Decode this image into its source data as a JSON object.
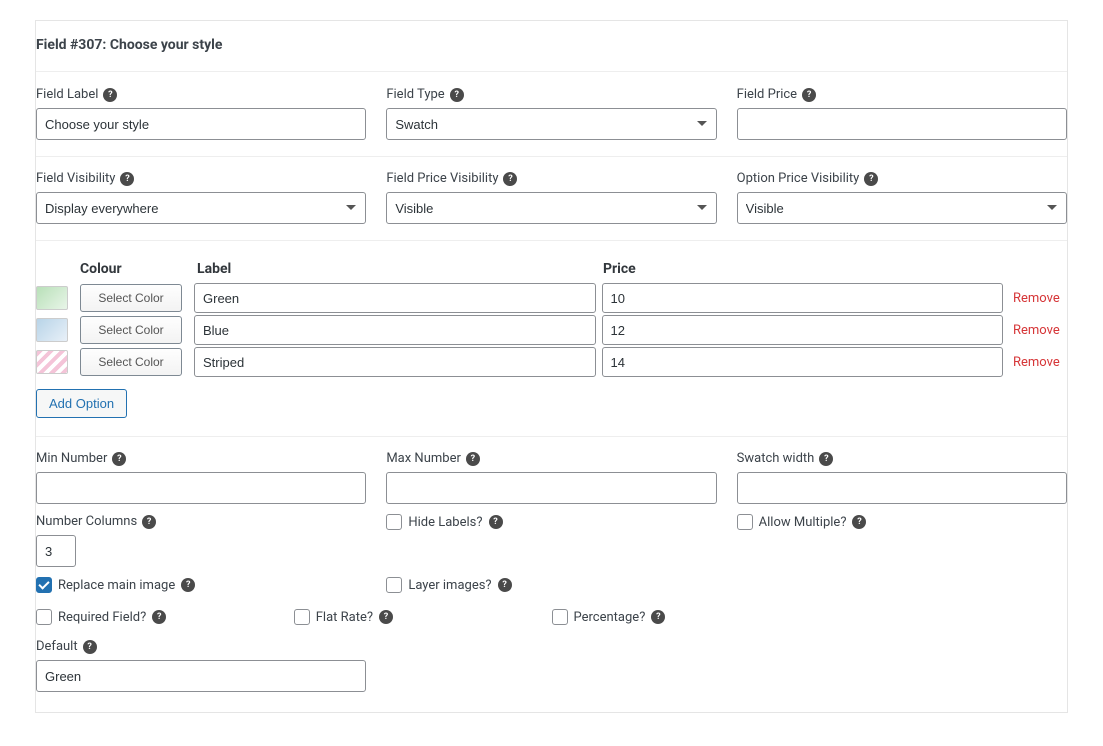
{
  "header": {
    "title": "Field #307: Choose your style"
  },
  "labels": {
    "field_label": "Field Label",
    "field_type": "Field Type",
    "field_price": "Field Price",
    "field_visibility": "Field Visibility",
    "field_price_visibility": "Field Price Visibility",
    "option_price_visibility": "Option Price Visibility",
    "min_number": "Min Number",
    "max_number": "Max Number",
    "swatch_width": "Swatch width",
    "number_columns": "Number Columns",
    "hide_labels": "Hide Labels?",
    "allow_multiple": "Allow Multiple?",
    "replace_main_image": "Replace main image",
    "layer_images": "Layer images?",
    "required_field": "Required Field?",
    "flat_rate": "Flat Rate?",
    "percentage": "Percentage?",
    "default": "Default",
    "add_option": "Add Option",
    "select_color": "Select Color",
    "remove": "Remove",
    "col_colour": "Colour",
    "col_label": "Label",
    "col_price": "Price"
  },
  "values": {
    "field_label": "Choose your style",
    "field_type": "Swatch",
    "field_price": "",
    "field_visibility": "Display everywhere",
    "field_price_visibility": "Visible",
    "option_price_visibility": "Visible",
    "min_number": "",
    "max_number": "",
    "swatch_width": "",
    "number_columns": "3",
    "default": "Green"
  },
  "checkboxes": {
    "hide_labels": false,
    "allow_multiple": false,
    "replace_main_image": true,
    "layer_images": false,
    "required_field": false,
    "flat_rate": false,
    "percentage": false
  },
  "options": [
    {
      "thumb": "green",
      "label": "Green",
      "price": "10"
    },
    {
      "thumb": "blue",
      "label": "Blue",
      "price": "12"
    },
    {
      "thumb": "stripe",
      "label": "Striped",
      "price": "14"
    }
  ]
}
